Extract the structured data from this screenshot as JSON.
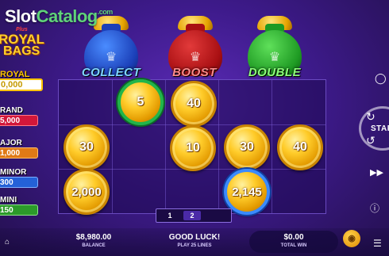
{
  "watermark": {
    "part1": "Slot",
    "part2": "Catalog",
    "part3": ".com"
  },
  "logo": {
    "plus": "Plus",
    "line1": "ROYAL",
    "line2": "BAGS"
  },
  "jackpots": [
    {
      "label": "ROYAL",
      "value": "0,000"
    },
    {
      "label": "RAND",
      "value": "5,000"
    },
    {
      "label": "AJOR",
      "value": "1,000"
    },
    {
      "label": "MINOR",
      "value": "300"
    },
    {
      "label": "MINI",
      "value": "150"
    }
  ],
  "bags": [
    {
      "label": "COLLECT",
      "color": "#1b3fb8"
    },
    {
      "label": "BOOST",
      "color": "#a80f12"
    },
    {
      "label": "DOUBLE",
      "color": "#1e9a23"
    }
  ],
  "coins": [
    {
      "value": "5",
      "ring": "green"
    },
    {
      "value": "40",
      "ring": "none"
    },
    {
      "value": "30",
      "ring": "none"
    },
    {
      "value": "10",
      "ring": "none"
    },
    {
      "value": "30",
      "ring": "none"
    },
    {
      "value": "40",
      "ring": "none"
    },
    {
      "value": "2,000",
      "ring": "none"
    },
    {
      "value": "2,145",
      "ring": "blue"
    }
  ],
  "pager": {
    "pages": [
      "1",
      "2"
    ],
    "active": "2"
  },
  "controls": {
    "start_label": "START",
    "sound_icon": "speaker-icon",
    "skip_icon": "fast-forward-icon",
    "info_icon": "info-icon",
    "home_icon": "home-icon",
    "menu_icon": "menu-icon",
    "bet_icon": "coin-stack-icon"
  },
  "status": {
    "balance_value": "$8,980.00",
    "balance_label": "BALANCE",
    "message": "GOOD LUCK!",
    "lines": "PLAY 25 LINES",
    "win_value": "$0.00",
    "win_label": "TOTAL WIN"
  }
}
